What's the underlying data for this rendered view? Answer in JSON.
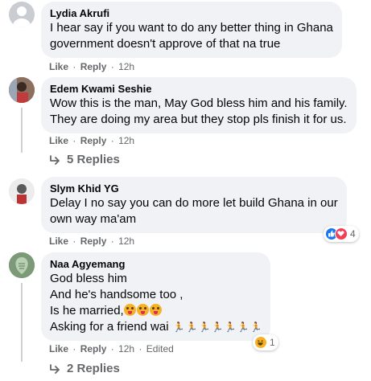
{
  "comments": [
    {
      "author": "Lydia Akrufi",
      "lines": [
        "I hear say if you want to do any better thing in Ghana",
        "government doesn't approve of that na true"
      ],
      "like": "Like",
      "reply": "Reply",
      "time": "12h"
    },
    {
      "author": "Edem Kwami Seshie",
      "lines": [
        "Wow this is the man, May God bless him and his family.",
        "They are doing my area but they stop pls finish it for us."
      ],
      "like": "Like",
      "reply": "Reply",
      "time": "12h",
      "replies": "5 Replies"
    },
    {
      "author": "Slym Khid YG",
      "lines": [
        "Delay I no say you can do more let build Ghana in our",
        "own way ma'am"
      ],
      "like": "Like",
      "reply": "Reply",
      "time": "12h",
      "reaction_count": "4"
    },
    {
      "author": "Naa Agyemang",
      "lines": [
        "God bless him",
        "And he's handsome too ,",
        "Is he married,",
        "Asking for a friend wai"
      ],
      "like": "Like",
      "reply": "Reply",
      "time": "12h",
      "edited": "Edited",
      "reaction_count": "1",
      "replies": "2 Replies"
    }
  ],
  "separator": "·",
  "colors": {
    "bubble": "#f0f2f5",
    "meta": "#65676b",
    "like_blue": "#1877f2",
    "love_red": "#f33e58",
    "haha_yellow": "#f7b125"
  },
  "icons": [
    "reply-arrow-icon",
    "like-reaction-icon",
    "love-reaction-icon",
    "haha-reaction-icon",
    "tongue-emoji-icon",
    "runner-emoji-icon"
  ]
}
